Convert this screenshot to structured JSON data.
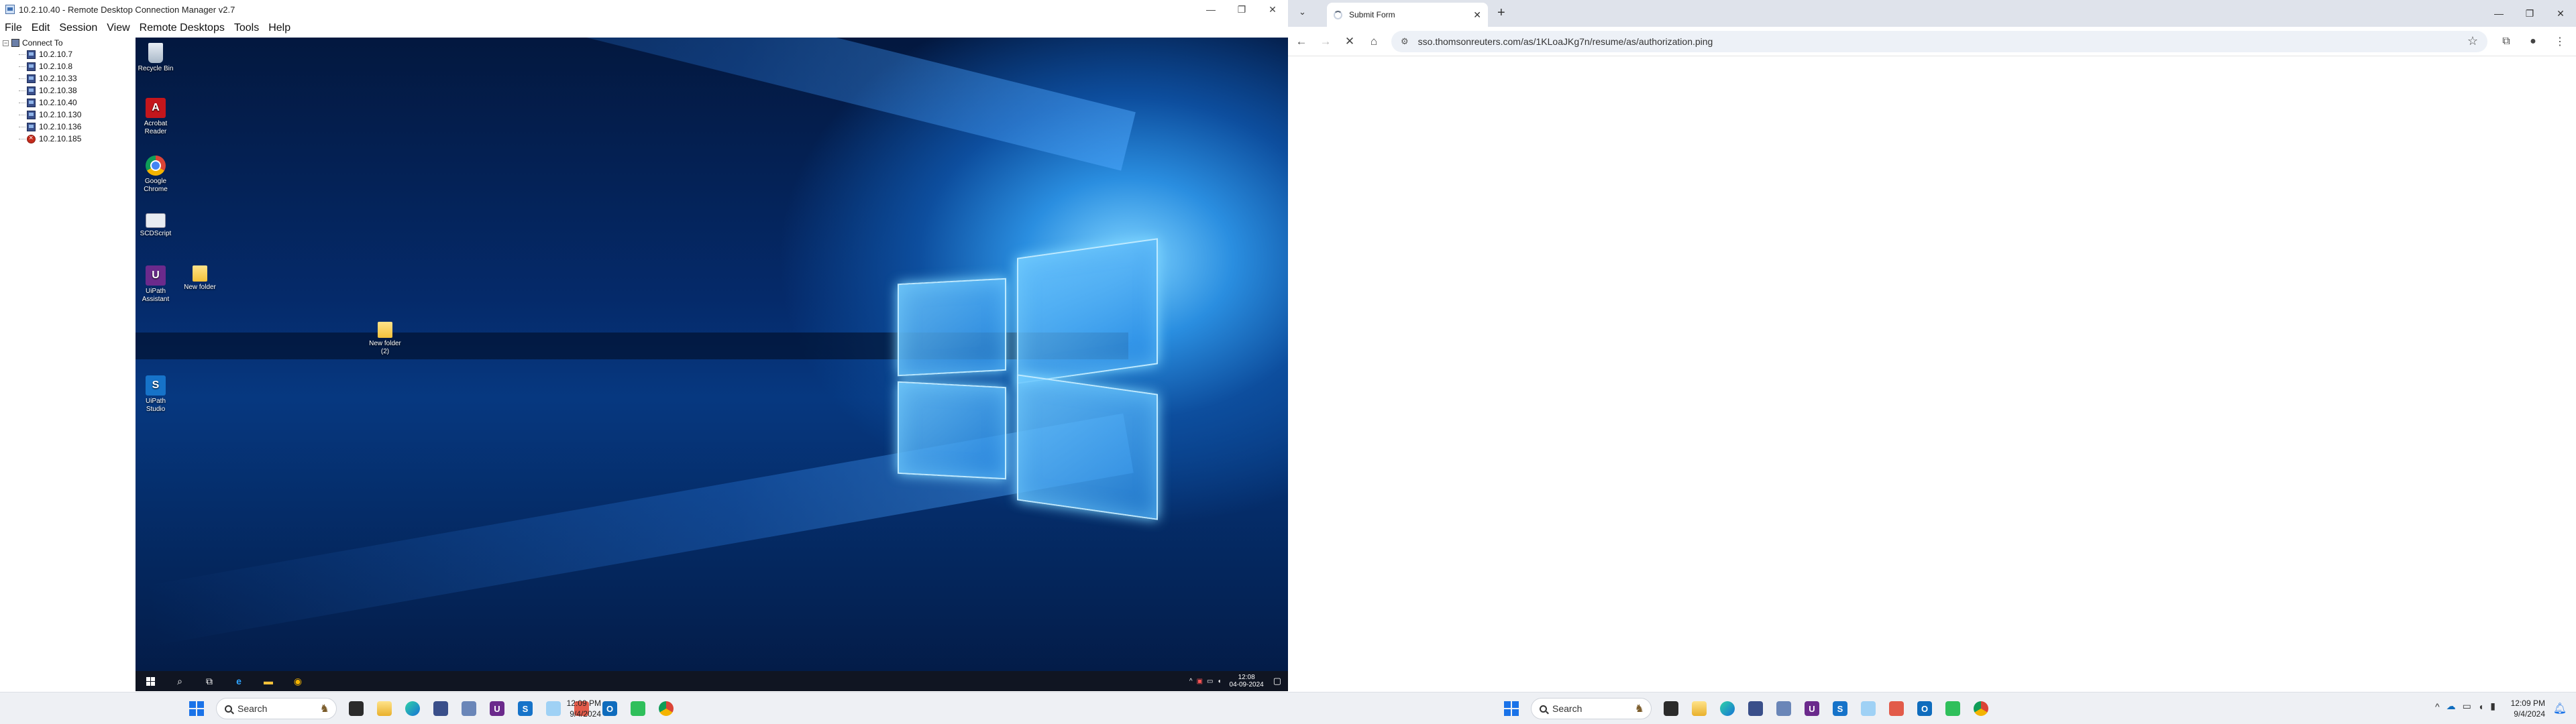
{
  "left_screen": {
    "rdcman": {
      "title": "10.2.10.40 - Remote Desktop Connection Manager v2.7",
      "window_controls": [
        "—",
        "❐",
        "✕"
      ],
      "menu": [
        "File",
        "Edit",
        "Session",
        "View",
        "Remote Desktops",
        "Tools",
        "Help"
      ],
      "tree": {
        "root_label": "Connect To",
        "servers": [
          "10.2.10.7",
          "10.2.10.8",
          "10.2.10.33",
          "10.2.10.38",
          "10.2.10.40",
          "10.2.10.130",
          "10.2.10.136",
          "10.2.10.185"
        ],
        "error_server": "10.2.10.185"
      },
      "remote_desktop": {
        "icons": {
          "recycle_bin": "Recycle Bin",
          "acrobat": "Acrobat Reader",
          "chrome": "Google Chrome",
          "scdscript": "SCDScript",
          "uipath_assistant": "UiPath Assistant",
          "new_folder": "New folder",
          "new_folder_2": "New folder (2)",
          "uipath_studio": "UiPath Studio"
        },
        "taskbar": {
          "time": "12:08",
          "date": "04-09-2024"
        }
      }
    },
    "taskbar": {
      "search_placeholder": "Search",
      "time": "12:09 PM",
      "date": "9/4/2024"
    }
  },
  "right_screen": {
    "chrome": {
      "tab_title": "Submit Form",
      "url": "sso.thomsonreuters.com/as/1KLoaJKg7n/resume/as/authorization.ping",
      "window_controls": [
        "—",
        "❐",
        "✕"
      ]
    },
    "taskbar": {
      "search_placeholder": "Search",
      "time": "12:09 PM",
      "date": "9/4/2024"
    }
  },
  "colors": {
    "accent": "#1a73e8",
    "desktop_dark": "#031a44",
    "desktop_glow": "#7fd3ff"
  }
}
